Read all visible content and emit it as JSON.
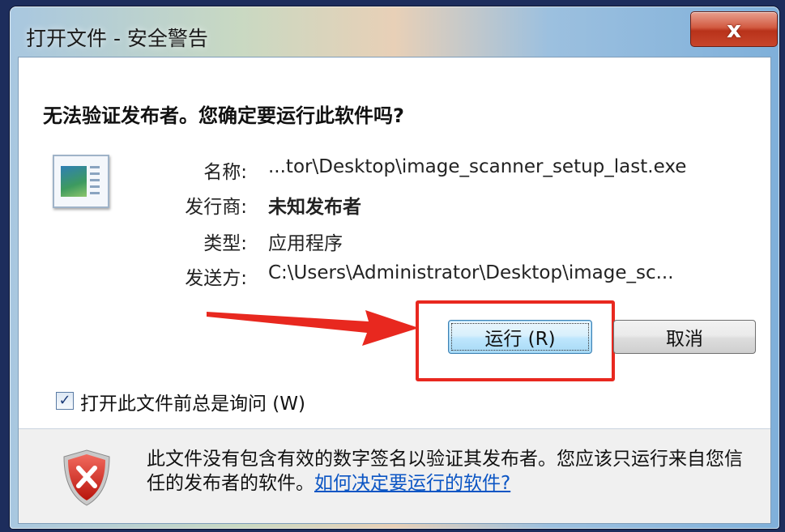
{
  "window": {
    "title": "打开文件 - 安全警告",
    "close_label": "x"
  },
  "dialog": {
    "heading": "无法验证发布者。您确定要运行此软件吗?",
    "fields": [
      {
        "label": "名称:",
        "value": "...tor\\Desktop\\image_scanner_setup_last.exe"
      },
      {
        "label": "发行商:",
        "value": "未知发布者"
      },
      {
        "label": "类型:",
        "value": "应用程序"
      },
      {
        "label": "发送方:",
        "value": "C:\\Users\\Administrator\\Desktop\\image_sc..."
      }
    ],
    "buttons": {
      "run_label": "运行 (R)",
      "cancel_label": "取消"
    },
    "checkbox": {
      "label": "打开此文件前总是询问 (W)",
      "checked": true
    },
    "warning": {
      "text": "此文件没有包含有效的数字签名以验证其发布者。您应该只运行来自您信任的发布者的软件。",
      "link": "如何决定要运行的软件?"
    }
  },
  "annotations": {
    "highlight_color": "#e8281f"
  },
  "icons": [
    "close-icon",
    "application-file-icon",
    "check-icon",
    "security-shield-icon",
    "red-arrow-annotation"
  ]
}
